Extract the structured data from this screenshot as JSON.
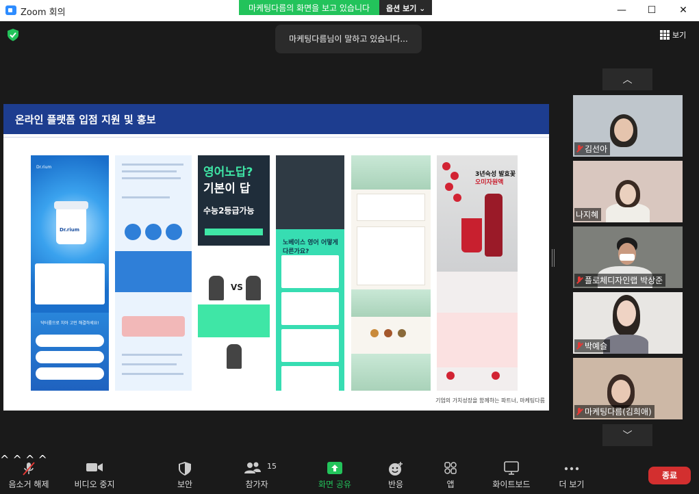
{
  "window": {
    "title": "Zoom 회의",
    "minimize_glyph": "—",
    "maximize_glyph": "☐",
    "close_glyph": "✕"
  },
  "share_banner": {
    "message": "마케팅다름의 화면을 보고 있습니다",
    "options_label": "옵션 보기 ⌄"
  },
  "speaker_indicator": "마케팅다름님이 말하고 있습니다...",
  "view_button": "보기",
  "slide": {
    "title": "온라인 플랫폼 입점 지원 및 홍보",
    "footer": "기업의 가치성장을 함께하는 파트너, 마케팅다름",
    "panels": {
      "p1": {
        "brand": "Dr.rium",
        "jar_label": "Dr.rium",
        "caption": "닥터륨으로 치아 고민 해결하세요!"
      },
      "p3": {
        "line1": "영어노답?",
        "line2": "기본이 답",
        "line3": "수능2등급가능",
        "vs": "VS"
      },
      "p4": {
        "text": "노베이스 영어 어떻게 다른가요?"
      },
      "p6": {
        "title1": "3년숙성 발효꽃",
        "title2": "오미자원액"
      }
    }
  },
  "gallery": {
    "up_arrow": "︿",
    "down_arrow": "﹀",
    "participants": [
      {
        "name": "김선아",
        "muted": true
      },
      {
        "name": "나지혜",
        "muted": false
      },
      {
        "name": "플로체디자인랩 박상준",
        "muted": true
      },
      {
        "name": "박예슬",
        "muted": true
      },
      {
        "name": "마케팅다름(김희애)",
        "muted": true
      }
    ]
  },
  "toolbar": {
    "mute_label": "음소거 해제",
    "video_label": "비디오 중지",
    "security_label": "보안",
    "participants_label": "참가자",
    "participants_count": "15",
    "share_label": "화면 공유",
    "reactions_label": "반응",
    "apps_label": "앱",
    "whiteboard_label": "화이트보드",
    "more_label": "더 보기",
    "end_label": "종료",
    "caret": "^"
  },
  "colors": {
    "share_banner": "#23c35b",
    "slide_header": "#1d3d8f",
    "end_button": "#d32f2f",
    "muted_icon": "#e53935"
  }
}
